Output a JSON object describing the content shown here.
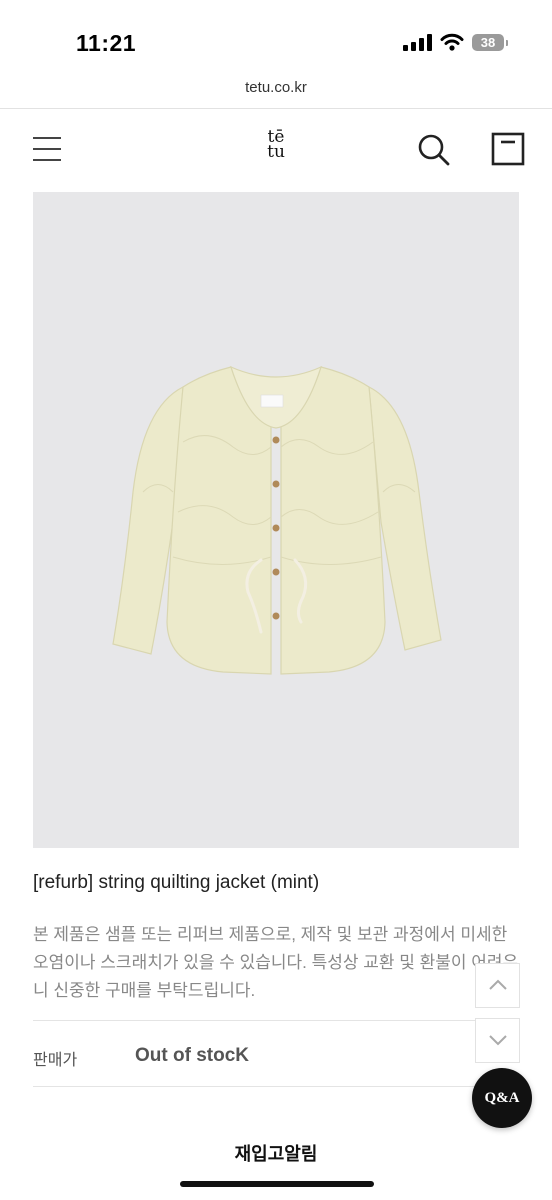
{
  "status_bar": {
    "time": "11:21",
    "battery": "38",
    "icons": [
      "signal-icon",
      "wifi-icon",
      "battery-icon"
    ]
  },
  "browser": {
    "url": "tetu.co.kr"
  },
  "header": {
    "logo_line1": "tē",
    "logo_line2": "tu",
    "icons": [
      "menu-icon",
      "search-icon",
      "cart-icon"
    ]
  },
  "product": {
    "image_desc": "mint quilted jacket",
    "title": "[refurb] string quilting jacket (mint)",
    "notice": "본 제품은 샘플 또는 리퍼브 제품으로, 제작 및 보관 과정에서 미세한 오염이나 스크래치가 있을 수 있습니다. 특성상 교환 및 환불이 어려우니 신중한 구매를 부탁드립니다.",
    "price_label": "판매가",
    "price_value": "Out of stocK"
  },
  "floating": {
    "qa_label": "Q&A",
    "scroll_up_icon": "chevron-up-icon",
    "scroll_down_icon": "chevron-down-icon"
  },
  "restock_label": "재입고알림",
  "colors": {
    "image_bg": "#e7e7e9",
    "jacket": "#eceacb",
    "qa_bg": "#111111",
    "muted_text": "#888888"
  }
}
